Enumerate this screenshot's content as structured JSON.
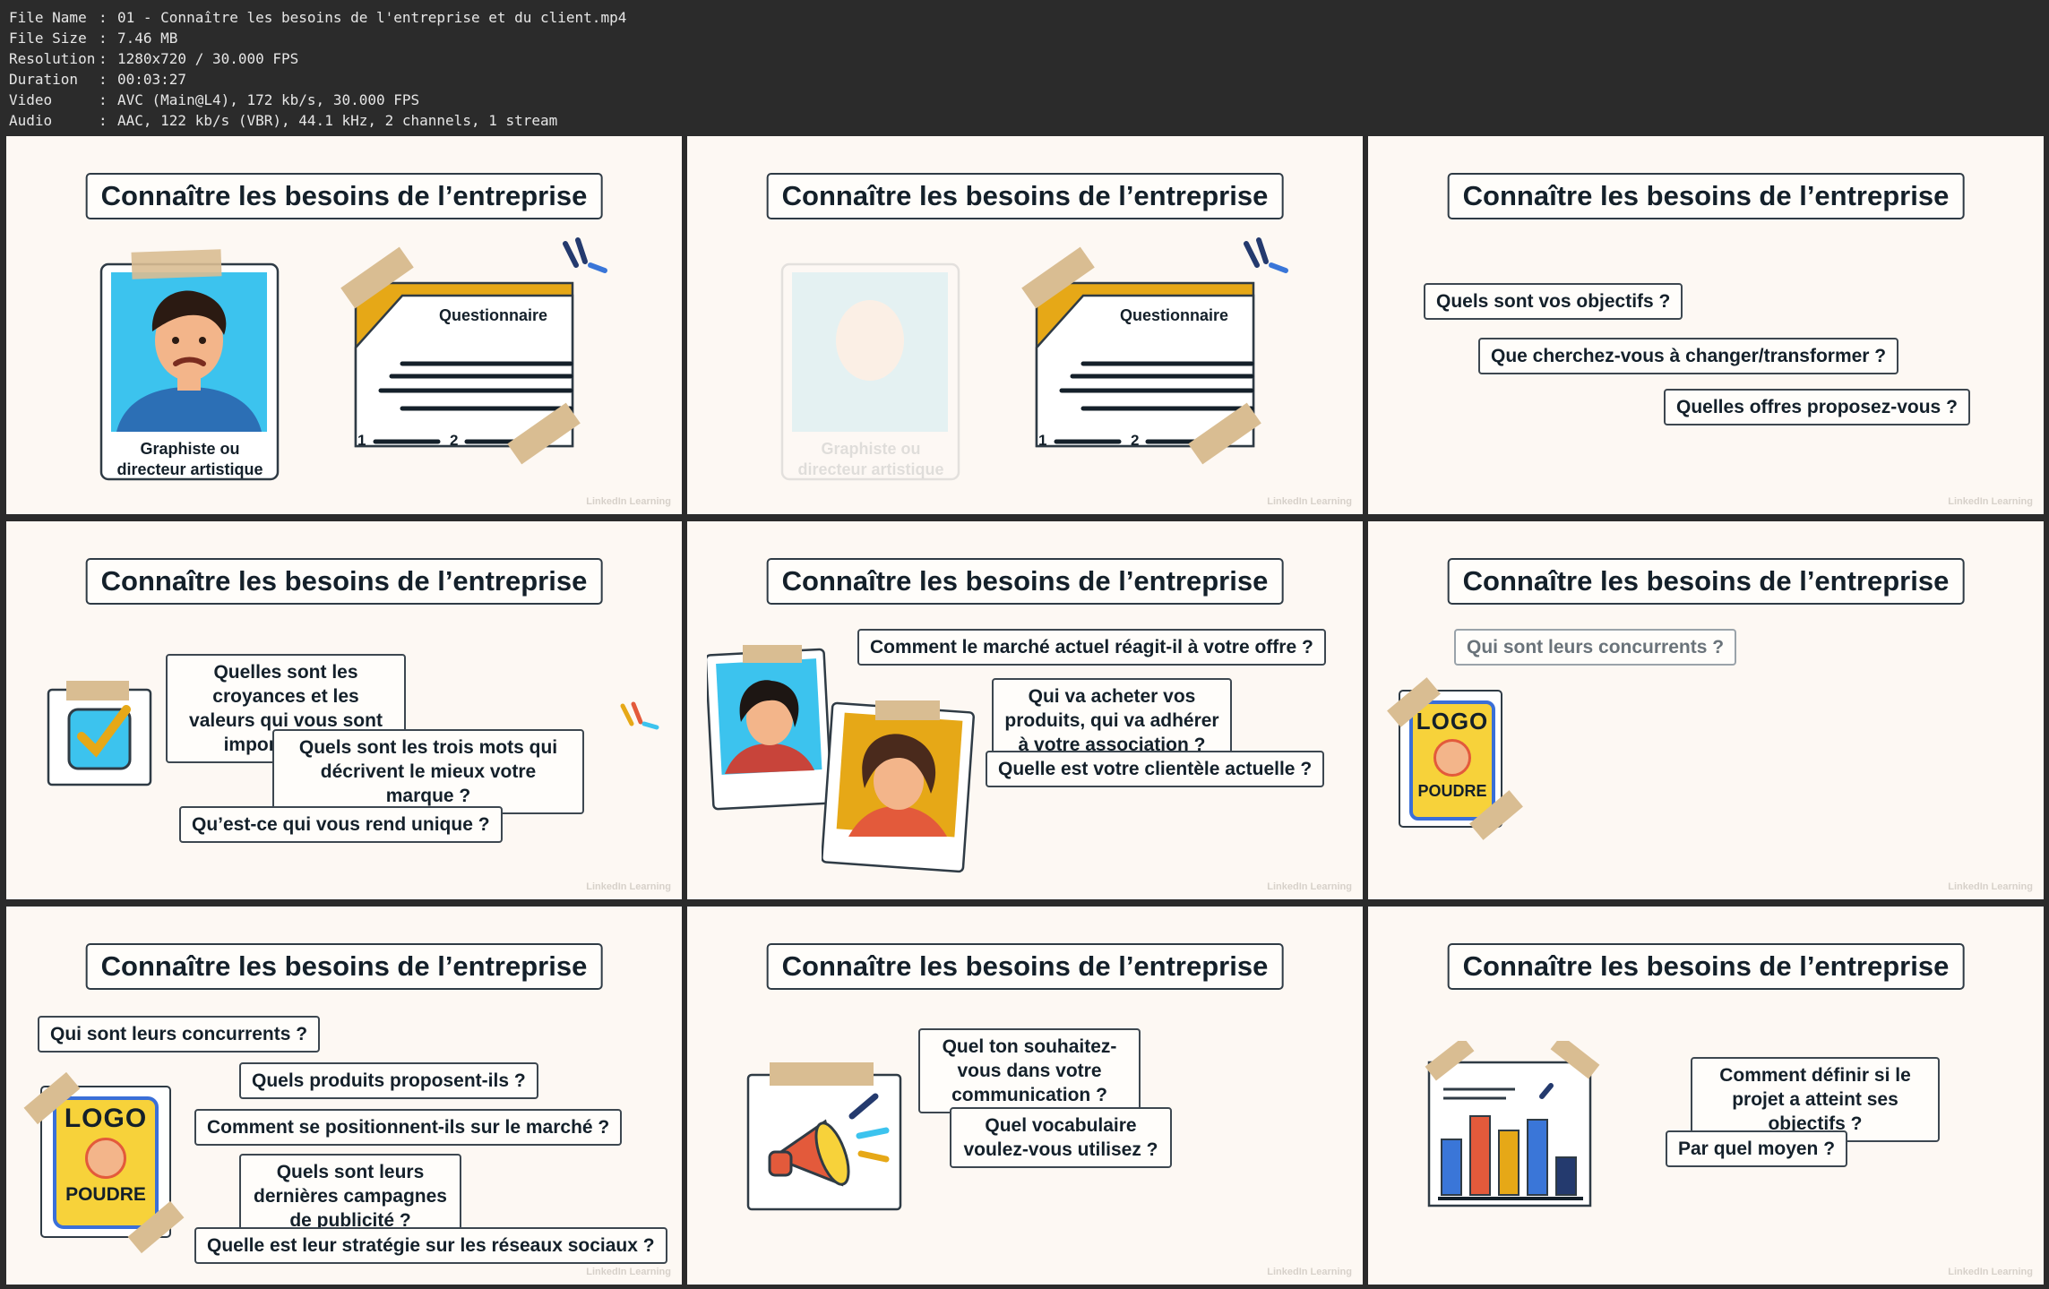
{
  "file_info": {
    "rows": [
      {
        "label": "File Name",
        "value": "01 - Connaître les besoins de l'entreprise et du client.mp4"
      },
      {
        "label": "File Size",
        "value": "7.46 MB"
      },
      {
        "label": "Resolution",
        "value": "1280x720 / 30.000 FPS"
      },
      {
        "label": "Duration",
        "value": "00:03:27"
      },
      {
        "label": "Video",
        "value": "AVC (Main@L4), 172 kb/s, 30.000 FPS"
      },
      {
        "label": "Audio",
        "value": "AAC, 122 kb/s (VBR), 44.1 kHz, 2 channels, 1 stream"
      }
    ],
    "separator": ":"
  },
  "slide_title": "Connaître les besoins de l’entreprise",
  "watermark": "LinkedIn Learning",
  "panels": [
    {
      "portrait_caption": "Graphiste ou directeur artistique",
      "questionnaire_label": "Questionnaire",
      "page_numbers": [
        "1",
        "2"
      ]
    },
    {
      "portrait_caption": "Graphiste ou directeur artistique",
      "questionnaire_label": "Questionnaire",
      "page_numbers": [
        "1",
        "2"
      ]
    },
    {
      "questions": [
        "Quels sont vos objectifs ?",
        "Que cherchez-vous à changer/transformer ?",
        "Quelles offres proposez-vous ?"
      ]
    },
    {
      "questions": [
        "Quelles sont les croyances et les valeurs qui vous sont importantes ?",
        "Quels sont les trois mots qui décrivent le mieux votre marque ?",
        "Qu’est-ce qui vous rend unique ?"
      ]
    },
    {
      "questions": [
        "Comment le marché actuel réagit-il à votre offre ?",
        "Qui va acheter vos produits, qui va adhérer à votre association ?",
        "Quelle est votre clientèle actuelle ?"
      ]
    },
    {
      "questions": [
        "Qui sont leurs concurrents ?"
      ],
      "logo_top": "LOGO",
      "logo_bottom": "POUDRE"
    },
    {
      "questions": [
        "Qui sont leurs concurrents ?",
        "Quels produits proposent-ils ?",
        "Comment se positionnent-ils sur le marché ?",
        "Quels sont leurs dernières campagnes de publicité ?",
        "Quelle est leur stratégie sur les réseaux sociaux ?"
      ],
      "logo_top": "LOGO",
      "logo_bottom": "POUDRE"
    },
    {
      "questions": [
        "Quel ton souhaitez-vous dans votre communication ?",
        "Quel vocabulaire voulez-vous utilisez ?"
      ]
    },
    {
      "questions": [
        "Comment définir si le projet a atteint ses objectifs ?",
        "Par quel moyen ?"
      ]
    }
  ],
  "colors": {
    "panel_bg": "#fdf8f3",
    "border_dark": "#2f3b45",
    "frame_bg": "#2b2b2b",
    "sky_blue": "#3cc3ee",
    "gold": "#e6a817",
    "tape": "#d9bd92"
  }
}
